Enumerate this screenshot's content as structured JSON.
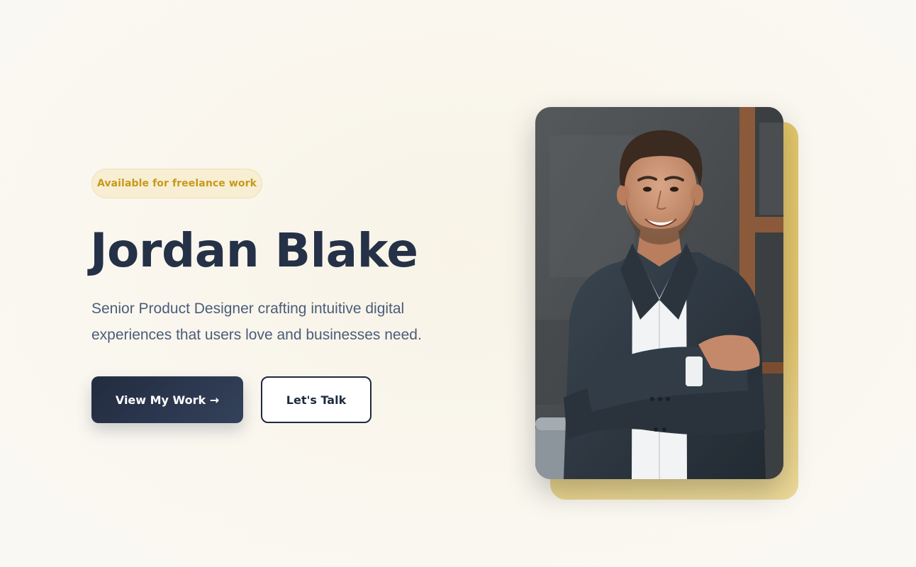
{
  "hero": {
    "badge": "Available for freelance work",
    "name": "Jordan Blake",
    "tagline": "Senior Product Designer crafting intuitive digital experiences that users love and businesses need.",
    "primary_button": "View My Work →",
    "secondary_button": "Let's Talk"
  },
  "colors": {
    "accent_gold": "#e3c768",
    "badge_text": "#c7991a",
    "heading": "#253147",
    "body_text": "#4a5d7a",
    "button_dark": "#222c40",
    "background": "#faf7ef"
  }
}
